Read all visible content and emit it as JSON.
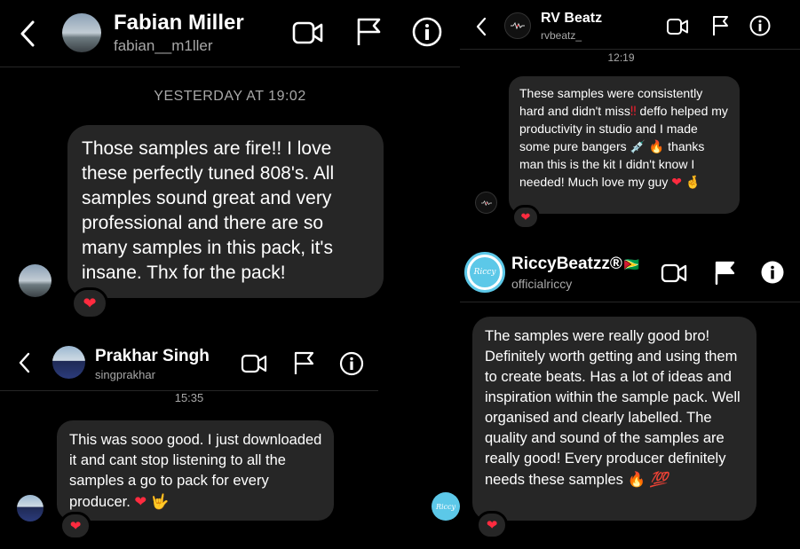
{
  "fabian": {
    "name": "Fabian Miller",
    "handle": "fabian__m1ller",
    "timestamp": "YESTERDAY AT 19:02",
    "message": "Those samples are fire!! I love these perfectly tuned 808's. All samples sound great and very professional and there are so many samples in this pack, it's insane. Thx for the pack!",
    "reaction": "❤"
  },
  "prakhar": {
    "name": "Prakhar Singh",
    "handle": "singprakhar",
    "timestamp": "15:35",
    "message": "This was sooo good. I just downloaded it and cant stop listening to all the samples a go to pack for every producer. ",
    "message_emoji_1": "❤",
    "message_emoji_2": "🤟",
    "reaction": "❤"
  },
  "rv": {
    "name": "RV Beatz",
    "handle": "rvbeatz_",
    "timestamp": "12:19",
    "message_part_1": "These samples were consistently hard and didn't miss",
    "message_emoji_1": "‼",
    "message_part_2": " deffo helped my productivity in studio and I made some pure bangers ",
    "message_emoji_2": "💉",
    "message_emoji_3": "🔥",
    "message_part_3": " thanks man this is the kit I didn't know I needed! Much love my guy ",
    "message_emoji_4": "❤",
    "message_emoji_5": "🤞",
    "reaction": "❤"
  },
  "riccy": {
    "name": "RiccyBeatzz®",
    "flag": "🇬🇾",
    "handle": "officialriccy",
    "avatar_text": "Riccy",
    "message": "The samples were really good bro! Definitely worth getting and using them to create beats. Has a lot of ideas and inspiration within the sample pack. Well organised and clearly labelled. The quality and sound of the samples are really good! Every producer definitely needs these samples ",
    "message_emoji_1": "🔥",
    "message_emoji_2": "💯",
    "reaction": "❤"
  },
  "icons": [
    "back-icon",
    "video-call-icon",
    "flag-icon",
    "info-icon"
  ],
  "colors": {
    "background": "#000000",
    "bubble": "#262626",
    "muted_text": "#a8a8a8",
    "heart": "#ff2b3f",
    "riccy_ring": "#5cc8e8"
  }
}
